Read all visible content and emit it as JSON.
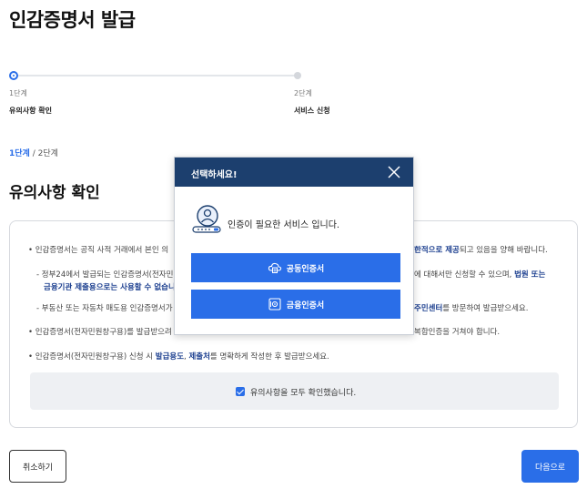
{
  "page": {
    "title": "인감증명서 발급"
  },
  "steps": [
    {
      "num": "1단계",
      "name": "유의사항 확인",
      "state": "active"
    },
    {
      "num": "2단계",
      "name": "서비스 신청",
      "state": "inactive"
    }
  ],
  "breadcrumb": {
    "current": "1단계",
    "separator": " / ",
    "next": "2단계"
  },
  "section": {
    "title": "유의사항 확인"
  },
  "notices": {
    "n1_a": "인감증명서는 공직 사적 거래에서 본인 의",
    "n1_hl": "한적으로 제공",
    "n1_b": "되고 있음을 양해 바랍니다.",
    "n2_a": "- 정부24에서 발급되는 인감증명서(전자민",
    "n2_b": "에 대해서만 신청할 수 있으며,",
    "n2_hl1": "법원 또는",
    "n2_hl2": "금융기관 제출용으로는 사용할 수 없습니",
    "n3_a": "- 부동산 또는 자동차 매도용 인감증명서가",
    "n3_hl": "주민센터",
    "n3_b": "를 방문하여 발급받으세요.",
    "n4_a": "인감증명서(전자민원창구용)를 발급받으려",
    "n4_b": "복합인증을 거쳐야 합니다.",
    "n5_a": "인감증명서(전자민원창구용) 신청 시",
    "n5_hl1": "발급용도",
    "n5_sep": ", ",
    "n5_hl2": "제출처",
    "n5_b": "를 명확하게 작성한 후 발급받으세요."
  },
  "confirm": {
    "label": "유의사항을 모두 확인했습니다.",
    "checked": true
  },
  "actions": {
    "cancel": "취소하기",
    "next": "다음으로"
  },
  "modal": {
    "title": "선택하세요!",
    "message": "인증이 필요한 서비스 입니다.",
    "options": [
      {
        "label": "공동인증서",
        "icon": "cloud-certificate-icon"
      },
      {
        "label": "금융인증서",
        "icon": "financial-certificate-icon"
      }
    ]
  },
  "colors": {
    "primary": "#2a6ee8",
    "modal_header": "#1c3f6e",
    "highlight": "#1b3e8f"
  }
}
